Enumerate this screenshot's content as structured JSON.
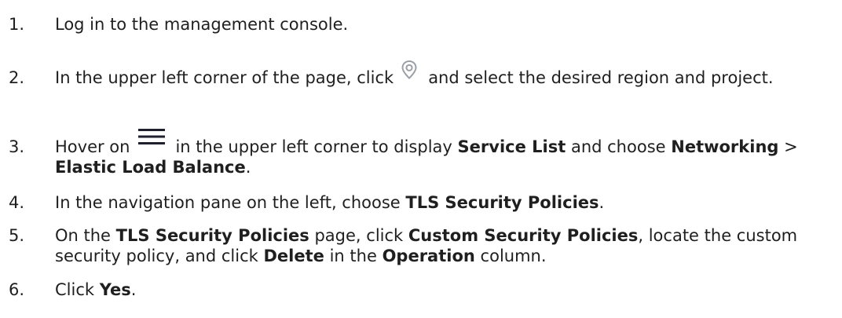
{
  "steps": [
    {
      "number": "1.",
      "parts": [
        "Log in to the management console."
      ]
    },
    {
      "number": "2.",
      "before_icon": "In the upper left corner of the page, click",
      "icon": "location-pin-icon",
      "after_icon": "and select the desired region and project."
    },
    {
      "number": "3.",
      "before_icon": "Hover on",
      "icon": "hamburger-menu-icon",
      "after_icon_1": "in the upper left corner to display",
      "bold_1": "Service List",
      "after_bold_1": "and choose",
      "bold_2": "Networking",
      "sep": ">",
      "bold_3": "Elastic Load Balance",
      "end": "."
    },
    {
      "number": "4.",
      "text_1": "In the navigation pane on the left, choose",
      "bold_1": "TLS Security Policies",
      "end": "."
    },
    {
      "number": "5.",
      "text_1": "On the",
      "bold_1": "TLS Security Policies",
      "text_2": "page, click",
      "bold_2": "Custom Security Policies",
      "text_3": ", locate the custom security policy, and click",
      "bold_3": "Delete",
      "text_4": "in the",
      "bold_4": "Operation",
      "text_5": "column."
    },
    {
      "number": "6.",
      "text_1": "Click",
      "bold_1": "Yes",
      "end": "."
    }
  ],
  "colors": {
    "text": "#1f1f1f",
    "icon_location": "#9aa0a6",
    "icon_menu": "#1f1f2e"
  }
}
